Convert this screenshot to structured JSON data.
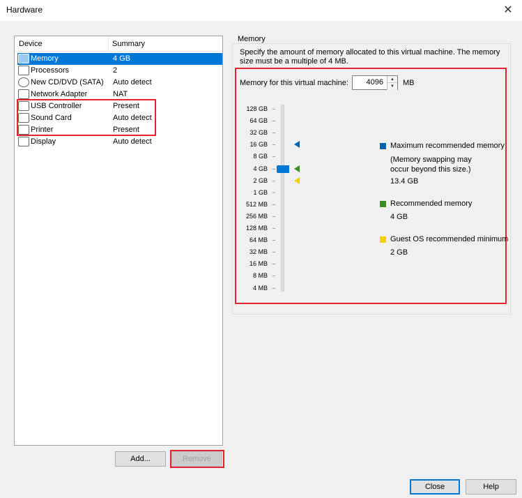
{
  "window": {
    "title": "Hardware",
    "close_glyph": "✕"
  },
  "device_list": {
    "col_device": "Device",
    "col_summary": "Summary",
    "rows": [
      {
        "name": "Memory",
        "summary": "4 GB",
        "icon": "memory-icon"
      },
      {
        "name": "Processors",
        "summary": "2",
        "icon": "processor-icon"
      },
      {
        "name": "New CD/DVD (SATA)",
        "summary": "Auto detect",
        "icon": "cd-dvd-icon"
      },
      {
        "name": "Network Adapter",
        "summary": "NAT",
        "icon": "network-adapter-icon"
      },
      {
        "name": "USB Controller",
        "summary": "Present",
        "icon": "usb-icon"
      },
      {
        "name": "Sound Card",
        "summary": "Auto detect",
        "icon": "speaker-icon"
      },
      {
        "name": "Printer",
        "summary": "Present",
        "icon": "printer-icon"
      },
      {
        "name": "Display",
        "summary": "Auto detect",
        "icon": "display-icon"
      }
    ]
  },
  "buttons": {
    "add": "Add...",
    "remove": "Remove",
    "close": "Close",
    "help": "Help"
  },
  "memory": {
    "group_label": "Memory",
    "description": "Specify the amount of memory allocated to this virtual machine. The memory size must be a multiple of 4 MB.",
    "field_label": "Memory for this virtual machine:",
    "value": "4096",
    "unit": "MB",
    "spin_up": "▲",
    "spin_down": "▼",
    "scale_labels": [
      "128 GB",
      "64 GB",
      "32 GB",
      "16 GB",
      "8 GB",
      "4 GB",
      "2 GB",
      "1 GB",
      "512 MB",
      "256 MB",
      "128 MB",
      "64 MB",
      "32 MB",
      "16 MB",
      "8 MB",
      "4 MB"
    ],
    "current_level": "4 GB",
    "legend": {
      "max": {
        "label": "Maximum recommended memory",
        "note": "(Memory swapping may occur beyond this size.)",
        "value": "13.4 GB",
        "color": "#0063b1",
        "level": "16 GB"
      },
      "rec": {
        "label": "Recommended memory",
        "value": "4 GB",
        "color": "#3c8c1e",
        "level": "4 GB"
      },
      "min": {
        "label": "Guest OS recommended minimum",
        "value": "2 GB",
        "color": "#f0d000",
        "level": "2 GB"
      }
    }
  },
  "highlight_color": "#e5222e"
}
